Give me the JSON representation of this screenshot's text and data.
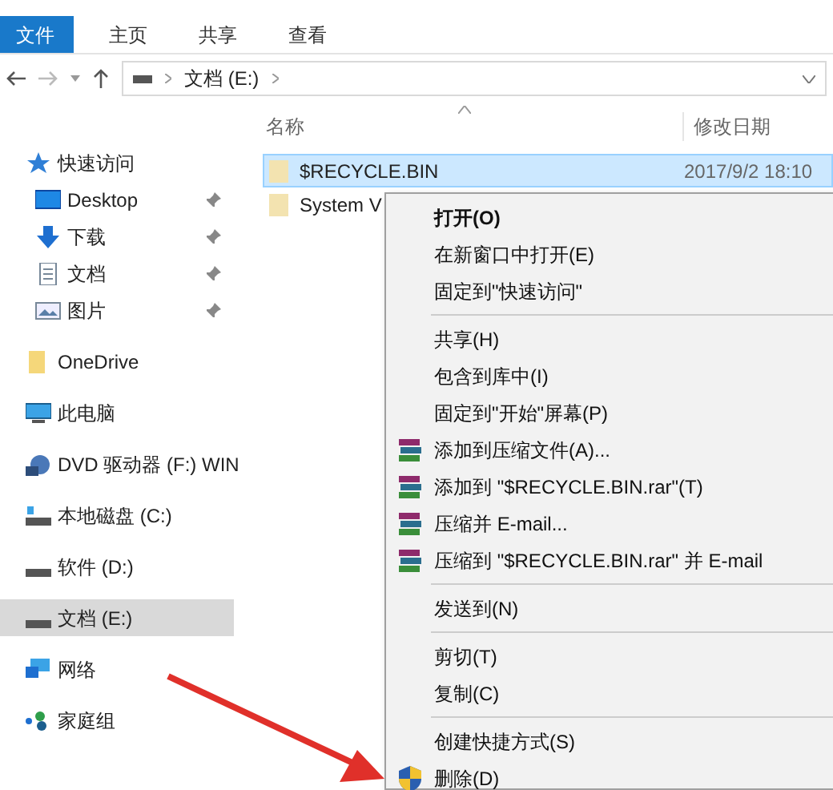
{
  "ribbon_tabs": [
    {
      "label": "文件",
      "selected": true
    },
    {
      "label": "主页",
      "selected": false
    },
    {
      "label": "共享",
      "selected": false
    },
    {
      "label": "查看",
      "selected": false
    }
  ],
  "address_bar": {
    "segments": [
      "文档 (E:)"
    ]
  },
  "columns": [
    "名称",
    "修改日期"
  ],
  "sidebar": {
    "items": [
      {
        "label": "快速访问",
        "kind": "star",
        "selected": false,
        "children": [
          {
            "label": "Desktop",
            "kind": "desktop",
            "pinned": true,
            "selected": false
          },
          {
            "label": "下载",
            "kind": "download",
            "pinned": true,
            "selected": false
          },
          {
            "label": "文档",
            "kind": "document",
            "pinned": true,
            "selected": false
          },
          {
            "label": "图片",
            "kind": "image",
            "pinned": true,
            "selected": false
          }
        ]
      },
      {
        "label": "OneDrive",
        "kind": "folder",
        "selected": false
      },
      {
        "label": "此电脑",
        "kind": "computer",
        "selected": false
      },
      {
        "label": "DVD 驱动器 (F:) WIN",
        "kind": "dvd",
        "selected": false
      },
      {
        "label": "本地磁盘 (C:)",
        "kind": "system-drive",
        "selected": false
      },
      {
        "label": "软件 (D:)",
        "kind": "drive",
        "selected": false
      },
      {
        "label": "文档 (E:)",
        "kind": "drive",
        "selected": true
      },
      {
        "label": "网络",
        "kind": "network",
        "selected": false
      },
      {
        "label": "家庭组",
        "kind": "homegroup",
        "selected": false
      }
    ]
  },
  "files": [
    {
      "name": "$RECYCLE.BIN",
      "modified": "2017/9/2 18:10",
      "selected": true
    },
    {
      "name": "System V",
      "selected": false
    }
  ],
  "context_menu": {
    "items": [
      {
        "kind": "item",
        "label": "打开(O)",
        "default": true
      },
      {
        "kind": "item",
        "label": "在新窗口中打开(E)"
      },
      {
        "kind": "item",
        "label": "固定到\"快速访问\""
      },
      {
        "kind": "separator"
      },
      {
        "kind": "item",
        "label": "共享(H)"
      },
      {
        "kind": "item",
        "label": "包含到库中(I)"
      },
      {
        "kind": "item",
        "label": "固定到\"开始\"屏幕(P)"
      },
      {
        "kind": "archive",
        "label": "添加到压缩文件(A)..."
      },
      {
        "kind": "archive",
        "label": "添加到 \"$RECYCLE.BIN.rar\"(T)"
      },
      {
        "kind": "archive",
        "label": "压缩并 E-mail..."
      },
      {
        "kind": "archive",
        "label": "压缩到 \"$RECYCLE.BIN.rar\" 并 E-mail"
      },
      {
        "kind": "separator"
      },
      {
        "kind": "item",
        "label": "发送到(N)"
      },
      {
        "kind": "separator"
      },
      {
        "kind": "item",
        "label": "剪切(T)"
      },
      {
        "kind": "item",
        "label": "复制(C)"
      },
      {
        "kind": "separator"
      },
      {
        "kind": "item",
        "label": "创建快捷方式(S)"
      },
      {
        "kind": "admin",
        "label": "删除(D)"
      }
    ]
  }
}
